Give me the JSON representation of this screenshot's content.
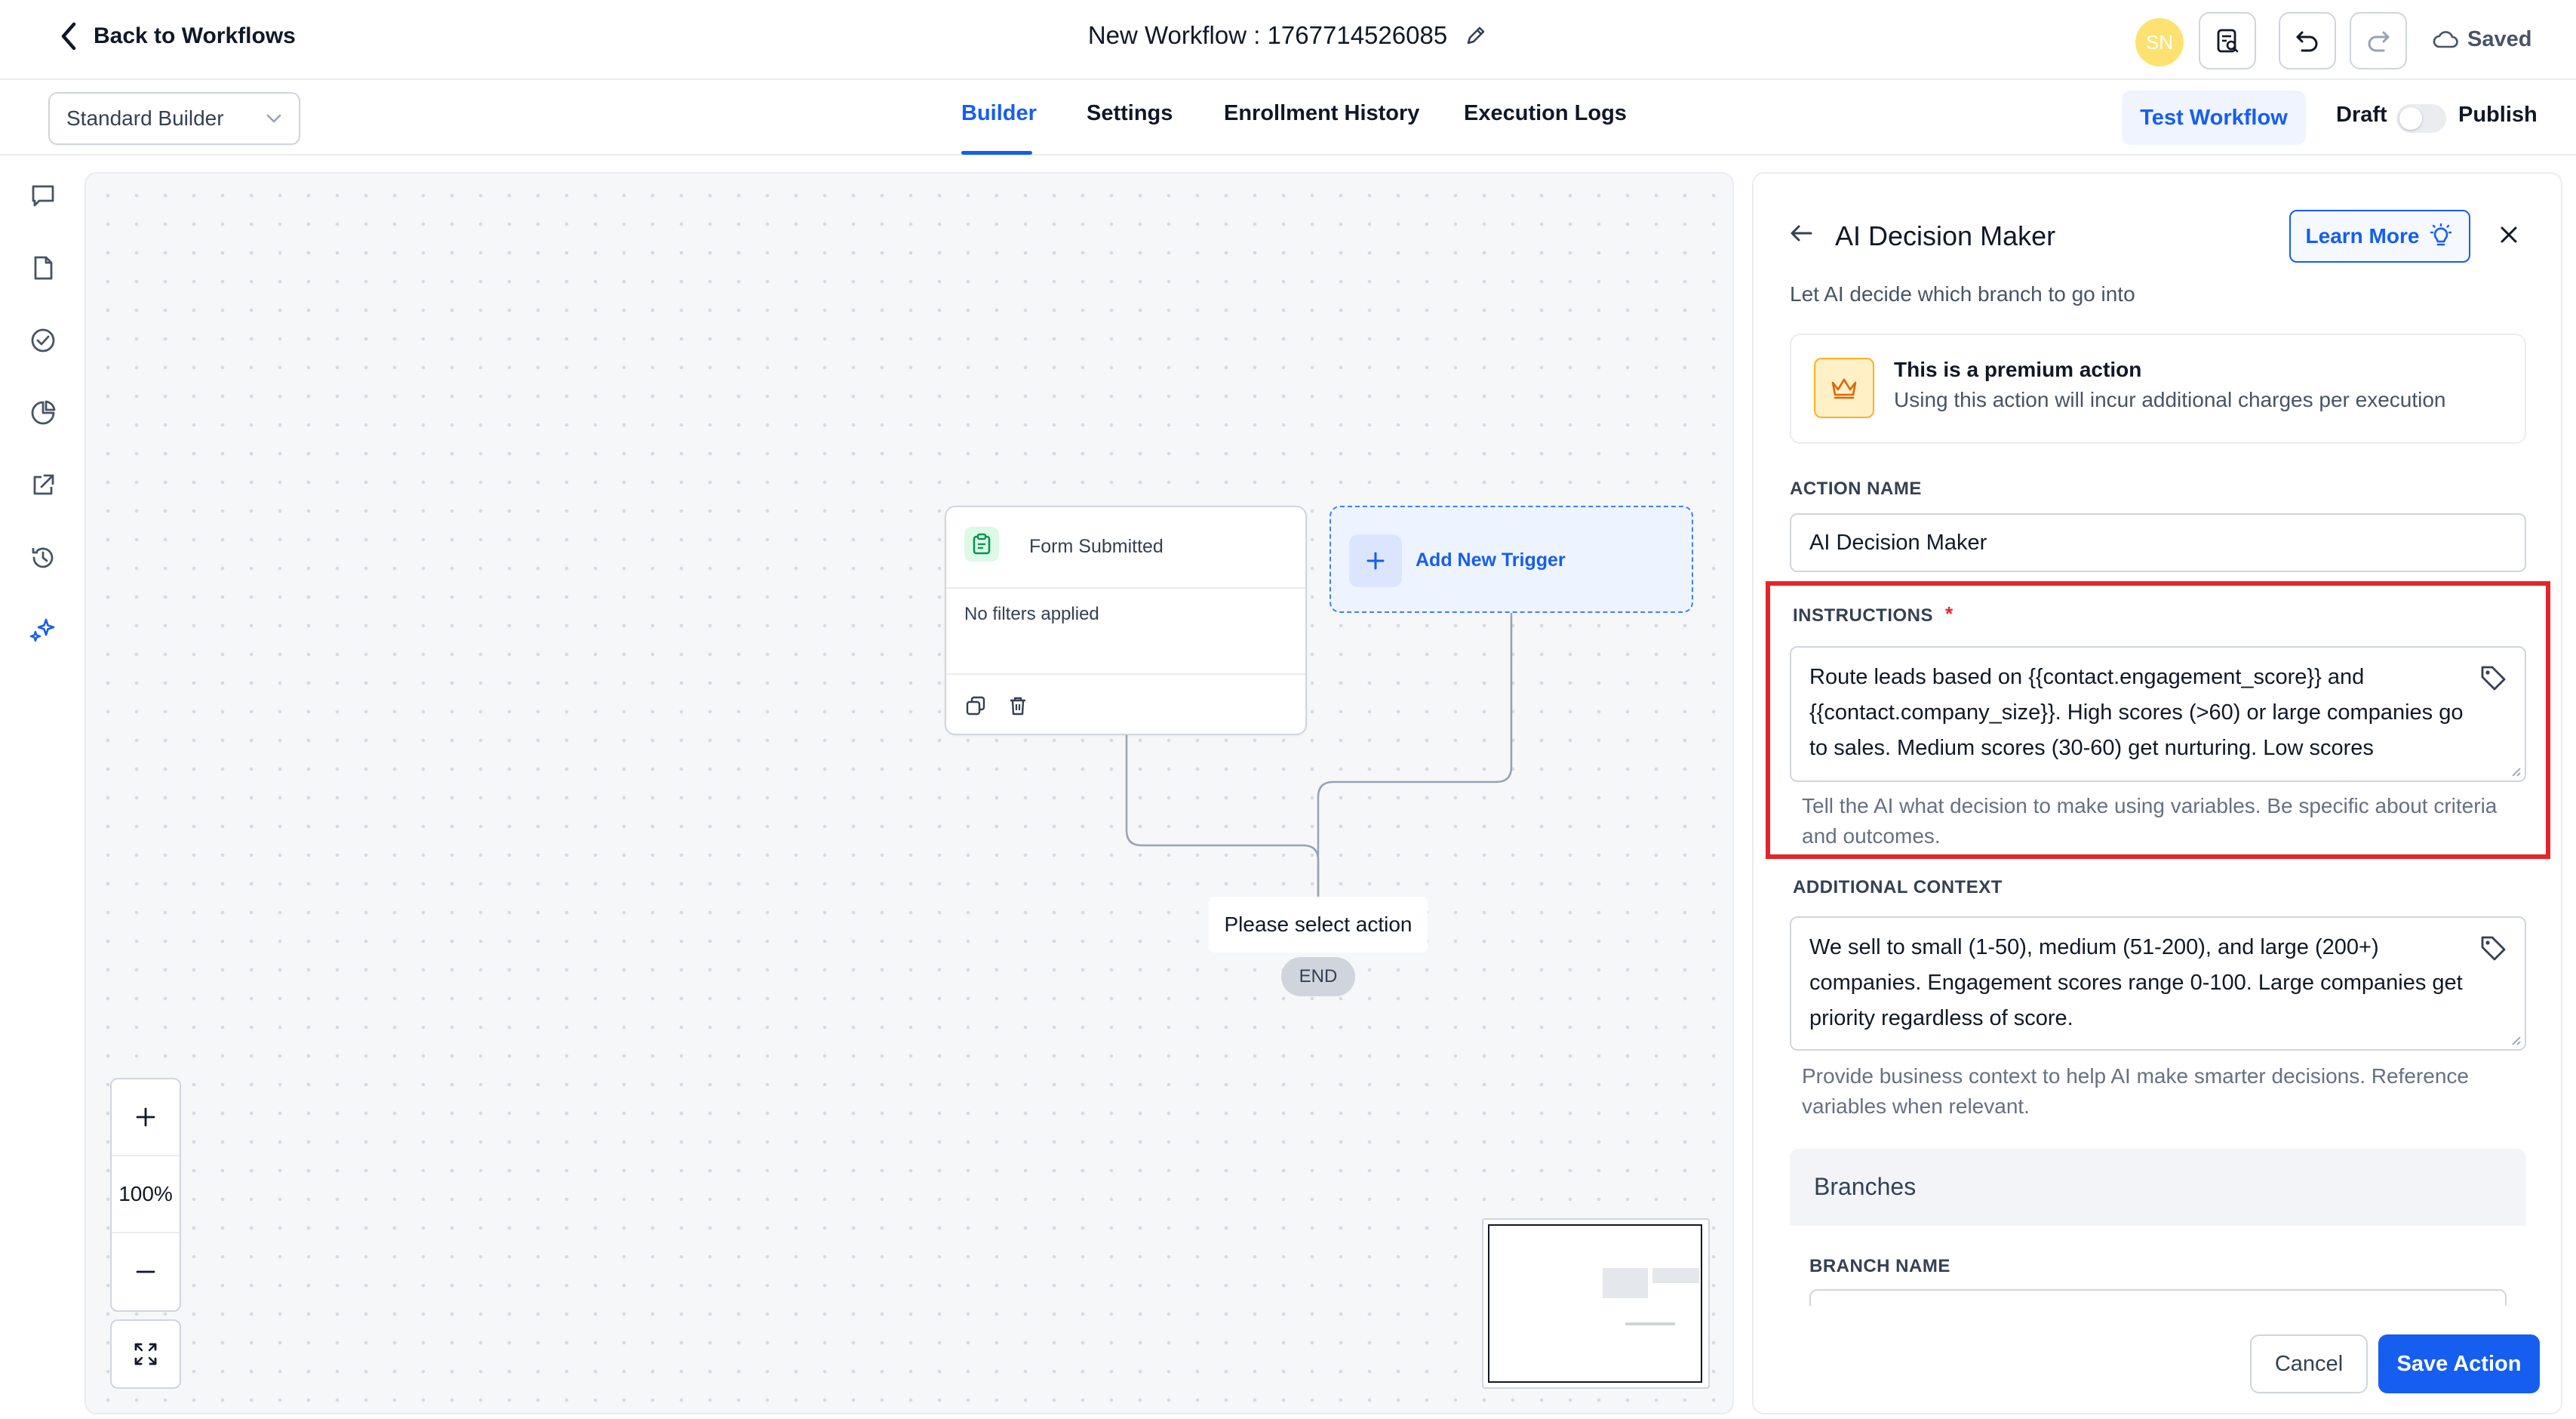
{
  "header": {
    "back_label": "Back to Workflows",
    "workflow_title": "New Workflow : 1767714526085",
    "avatar_initials": "SN",
    "saved_label": "Saved"
  },
  "toolbar": {
    "builder_select": "Standard Builder",
    "tabs": [
      "Builder",
      "Settings",
      "Enrollment History",
      "Execution Logs"
    ],
    "active_tab": "Builder",
    "test_button": "Test Workflow",
    "draft_label": "Draft",
    "publish_label": "Publish",
    "publish_enabled": false
  },
  "sidebar": {
    "icons": [
      "chat-icon",
      "file-icon",
      "check-circle-icon",
      "pie-chart-icon",
      "external-link-icon",
      "history-icon",
      "sparkle-icon"
    ]
  },
  "canvas": {
    "trigger_node": {
      "title": "Form Submitted",
      "filters": "No filters applied"
    },
    "add_trigger": "Add New Trigger",
    "action_placeholder": "Please select action",
    "end_label": "END",
    "zoom": {
      "in": "+",
      "level": "100%",
      "out": "−"
    }
  },
  "panel": {
    "title": "AI Decision Maker",
    "learn_more": "Learn More",
    "subtitle": "Let AI decide which branch to go into",
    "premium": {
      "title": "This is a premium action",
      "description": "Using this action will incur additional charges per execution"
    },
    "action_name": {
      "label": "ACTION NAME",
      "value": "AI Decision Maker"
    },
    "instructions": {
      "label": "INSTRUCTIONS",
      "required_mark": "*",
      "value": "Route leads based on {{contact.engagement_score}} and {{contact.company_size}}. High scores (>60) or large companies go to sales. Medium scores (30-60) get nurturing. Low scores",
      "hint": "Tell the AI what decision to make using variables. Be specific about criteria and outcomes."
    },
    "additional_context": {
      "label": "ADDITIONAL CONTEXT",
      "value": "We sell to small (1-50), medium (51-200), and large (200+) companies. Engagement scores range 0-100. Large companies get priority regardless of score.",
      "hint": "Provide business context to help AI make smarter decisions. Reference variables when relevant."
    },
    "branches": {
      "title": "Branches",
      "branch_name_label": "BRANCH NAME"
    },
    "cancel_button": "Cancel",
    "save_button": "Save Action"
  },
  "colors": {
    "accent": "#155eef",
    "highlight_border": "#e5242a",
    "premium_icon_bg": "#fef0c7"
  }
}
